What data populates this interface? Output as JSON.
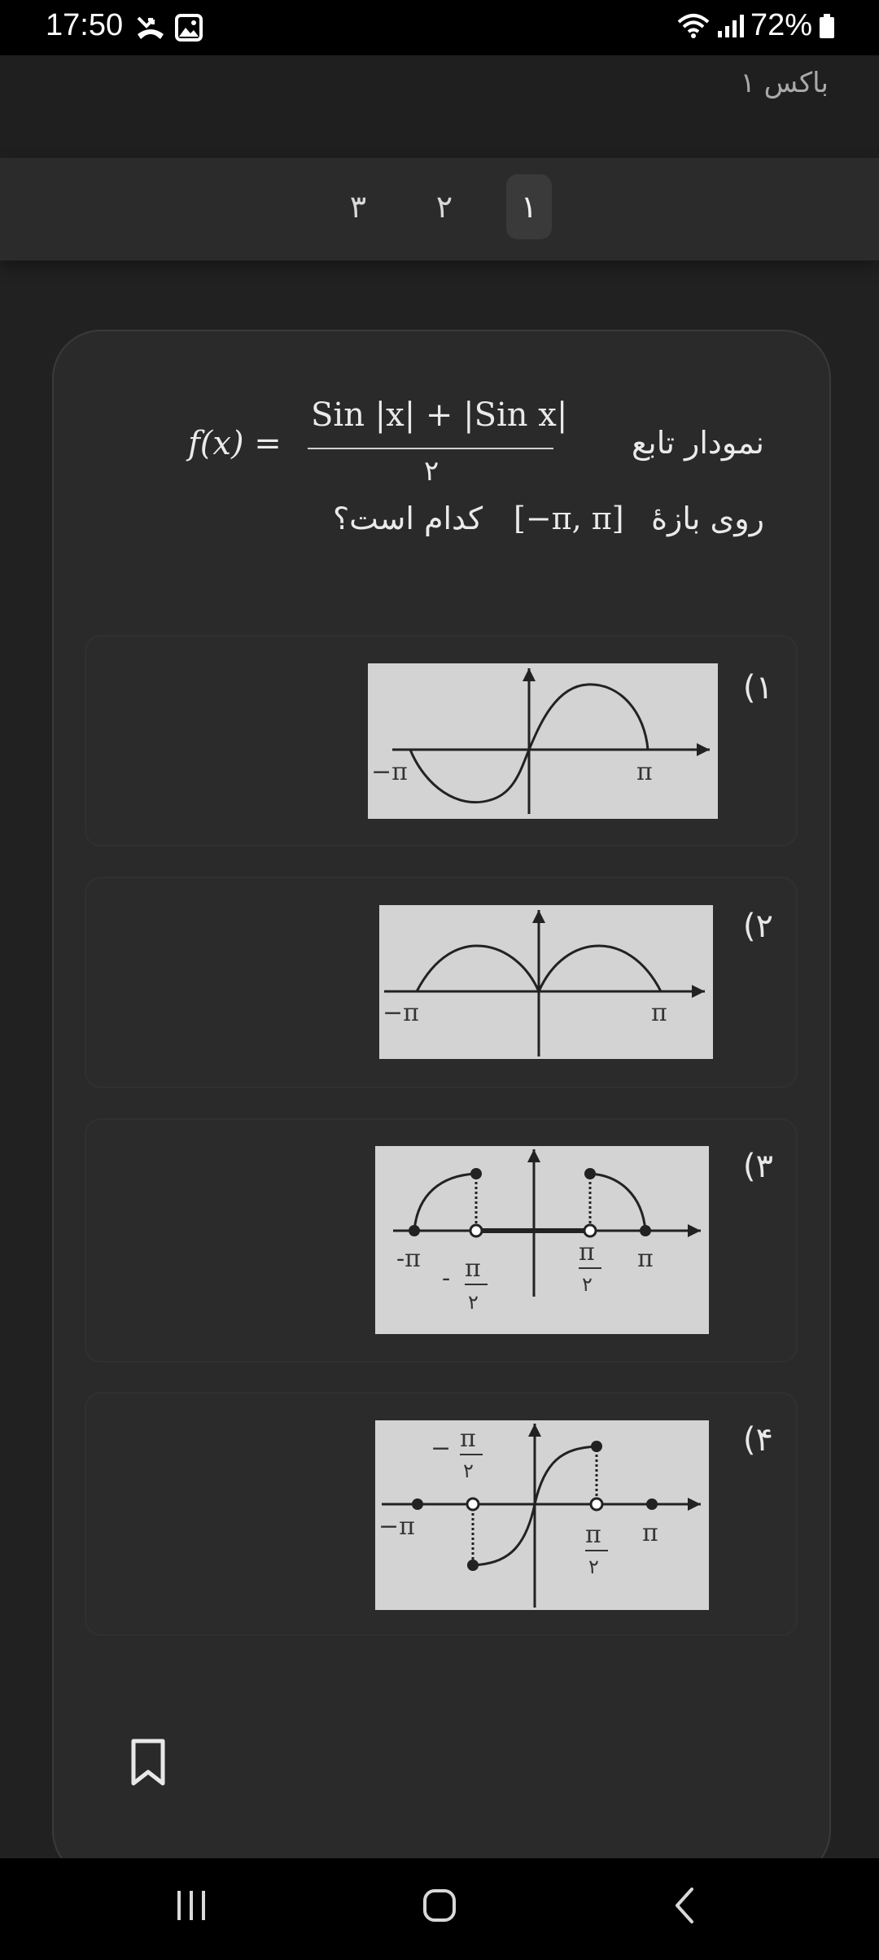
{
  "status": {
    "time": "17:50",
    "battery": "72%",
    "icons": [
      "missed-call-icon",
      "gallery-icon",
      "wifi-icon",
      "signal-icon",
      "battery-icon"
    ]
  },
  "header": {
    "title": "باکس ۱"
  },
  "tabs": [
    {
      "label": "۱",
      "active": true
    },
    {
      "label": "۲",
      "active": false
    },
    {
      "label": "۳",
      "active": false
    }
  ],
  "question": {
    "line1": "نمودار تابع",
    "line2_pre": "روی بازهٔ",
    "line2_post": "کدام است؟",
    "formula_lhs": "f(x) =",
    "formula_num": "Sin |x| + |Sin x|",
    "formula_den": "۲",
    "interval": "[−π, π]"
  },
  "options": [
    {
      "num": "۱)",
      "labels": {
        "neg_pi": "−π",
        "pi": "π"
      }
    },
    {
      "num": "۲)",
      "labels": {
        "neg_pi": "−π",
        "pi": "π"
      }
    },
    {
      "num": "۳)",
      "labels": {
        "neg_pi": "-π",
        "pi": "π",
        "half_pi": "π",
        "half_den": "۲",
        "neg_sign": "-"
      }
    },
    {
      "num": "۴)",
      "labels": {
        "neg_pi": "−π",
        "pi": "π",
        "half_pi": "π",
        "half_den": "۲",
        "neg_sign": "−"
      }
    }
  ],
  "colors": {
    "background": "#212121",
    "card": "#2a2a2a",
    "graph_bg": "#d3d3d3"
  }
}
